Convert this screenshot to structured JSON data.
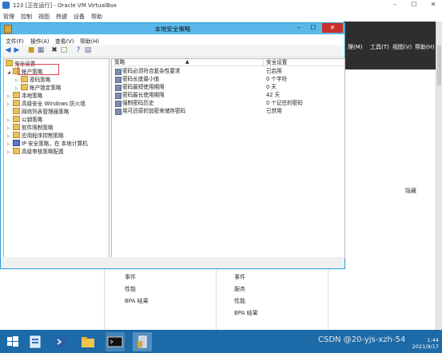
{
  "vbox": {
    "title": "123 [正在运行] - Oracle VM VirtualBox",
    "menu": [
      "管理",
      "控制",
      "视图",
      "热键",
      "设备",
      "帮助"
    ]
  },
  "server_manager": {
    "top_menu": [
      "理(M)",
      "工具(T)",
      "视图(V)",
      "帮助(H)"
    ],
    "hide_label": "隐藏",
    "bottom_col1": [
      "事件",
      "性能",
      "BPA 结果"
    ],
    "bottom_col2": [
      "事件",
      "服务",
      "性能",
      "BPA 结果"
    ]
  },
  "lsp": {
    "title": "本地安全策略",
    "menu": [
      "文件(F)",
      "操作(A)",
      "查看(V)",
      "帮助(H)"
    ],
    "tree": [
      {
        "label": "安全设置",
        "level": 0,
        "expanded": true
      },
      {
        "label": "帐户策略",
        "level": 1,
        "expanded": true
      },
      {
        "label": "密码策略",
        "level": 2,
        "expanded": false,
        "selected": true
      },
      {
        "label": "帐户锁定策略",
        "level": 2,
        "expanded": false
      },
      {
        "label": "本地策略",
        "level": 1,
        "expanded": false
      },
      {
        "label": "高级安全 Windows 防火墙",
        "level": 1,
        "expanded": false
      },
      {
        "label": "网络列表管理器策略",
        "level": 1,
        "expanded": false
      },
      {
        "label": "公钥策略",
        "level": 1,
        "expanded": false
      },
      {
        "label": "软件限制策略",
        "level": 1,
        "expanded": false
      },
      {
        "label": "应用程序控制策略",
        "level": 1,
        "expanded": false
      },
      {
        "label": "IP 安全策略，在 本地计算机",
        "level": 1,
        "expanded": false
      },
      {
        "label": "高级审核策略配置",
        "level": 1,
        "expanded": false
      }
    ],
    "columns": {
      "policy": "策略",
      "setting": "安全设置"
    },
    "rows": [
      {
        "policy": "密码必须符合复杂性要求",
        "setting": "已启用"
      },
      {
        "policy": "密码长度最小值",
        "setting": "0 个字符"
      },
      {
        "policy": "密码最短使用期限",
        "setting": "0 天"
      },
      {
        "policy": "密码最长使用期限",
        "setting": "42 天"
      },
      {
        "policy": "强制密码历史",
        "setting": "0 个记住的密码"
      },
      {
        "policy": "用可还原的加密来储存密码",
        "setting": "已禁用"
      }
    ]
  },
  "taskbar": {
    "time": "1:44",
    "date": "2021/9/17"
  },
  "watermark": "CSDN @20-yjs-xzh-54"
}
